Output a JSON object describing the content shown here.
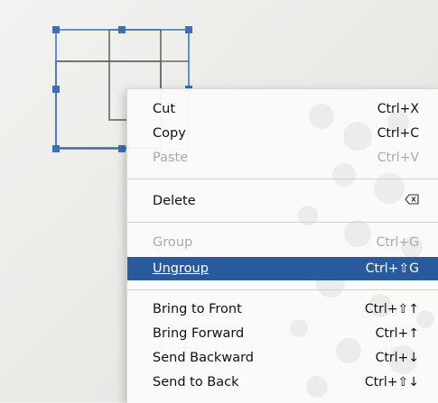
{
  "colors": {
    "highlight": "#285a9d",
    "selection_handle": "#3d6fb6",
    "disabled_text": "#aaaaaa"
  },
  "menu": {
    "groups": [
      [
        {
          "label": "Cut",
          "shortcut": "Ctrl+X",
          "enabled": true
        },
        {
          "label": "Copy",
          "shortcut": "Ctrl+C",
          "enabled": true
        },
        {
          "label": "Paste",
          "shortcut": "Ctrl+V",
          "enabled": false
        }
      ],
      [
        {
          "label": "Delete",
          "shortcut_icon": "backspace-icon",
          "enabled": true
        }
      ],
      [
        {
          "label": "Group",
          "shortcut": "Ctrl+G",
          "enabled": false
        },
        {
          "label": "Ungroup",
          "shortcut": "Ctrl+⇧G",
          "enabled": true,
          "highlighted": true
        }
      ],
      [
        {
          "label": "Bring to Front",
          "shortcut": "Ctrl+⇧↑",
          "enabled": true
        },
        {
          "label": "Bring Forward",
          "shortcut": "Ctrl+↑",
          "enabled": true
        },
        {
          "label": "Send Backward",
          "shortcut": "Ctrl+↓",
          "enabled": true
        },
        {
          "label": "Send to Back",
          "shortcut": "Ctrl+⇧↓",
          "enabled": true
        }
      ]
    ]
  }
}
